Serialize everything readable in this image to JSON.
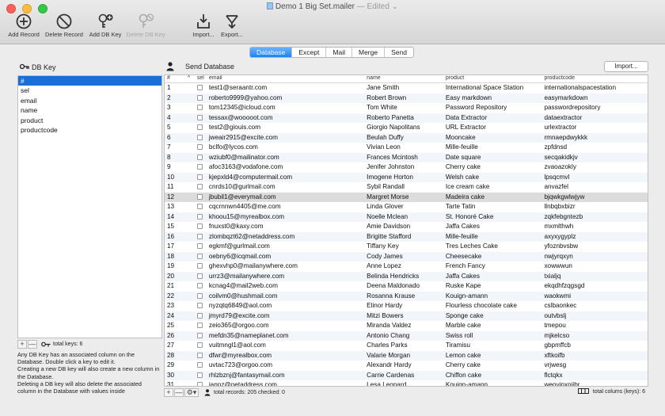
{
  "window": {
    "title": "Demo 1 Big Set.mailer",
    "edited": "— Edited",
    "chevron": "⌄"
  },
  "toolbar": {
    "add_record": "Add Record",
    "delete_record": "Delete Record",
    "add_db_key": "Add DB Key",
    "delete_db_key": "Delete DB Key",
    "import": "Import...",
    "export": "Export..."
  },
  "tabs": [
    "Database",
    "Except",
    "Mail",
    "Merge",
    "Send"
  ],
  "active_tab": "Database",
  "left": {
    "header": "DB Key",
    "keys": [
      "#",
      "sel",
      "email",
      "name",
      "product",
      "productcode"
    ],
    "selected_key": "#",
    "add": "+",
    "remove": "—",
    "total_keys": "total keys: 6",
    "help": "Any DB Key has an associated column on the Database. Double click a key to edit it.\nCreating a new DB key will also create a new column in the Database.\nDeleting a DB key will also delete the associated column in the Database with values inside"
  },
  "right": {
    "header": "Send Database",
    "import_button": "Import...",
    "columns": {
      "num": "#",
      "sort": "^",
      "sel": "sel",
      "email": "email",
      "name": "name",
      "product": "product",
      "productcode": "productcode"
    },
    "rows": [
      [
        "1",
        "test1@seraantr.com",
        "Jane Smith",
        "International Space Station",
        "internationalspacestation"
      ],
      [
        "2",
        "roberto9999@yahoo.com",
        "Robert Brown",
        "Easy markdown",
        "easymarkdown"
      ],
      [
        "3",
        "tom12345@icloud.com",
        "Tom White",
        "Password Repository",
        "passwordrepository"
      ],
      [
        "4",
        "tessax@wooooot.com",
        "Roberto Panetta",
        "Data Extractor",
        "dataextractor"
      ],
      [
        "5",
        "test2@giouis.com",
        "Giorgio Napolitans",
        "URL Extractor",
        "urlextractor"
      ],
      [
        "6",
        "jweair2915@excite.com",
        "Beulah Duffy",
        "Mooncake",
        "rmnaepdwykkk"
      ],
      [
        "7",
        "bclfo@lycos.com",
        "Vivian Leon",
        "Mille-feuille",
        "zpfdnsd"
      ],
      [
        "8",
        "wziubf0@mailinator.com",
        "Frances Mcintosh",
        "Date square",
        "secqakidkjv"
      ],
      [
        "9",
        "afoc3163@vodafone.com",
        "Jenifer Johnston",
        "Cherry cake",
        "zvaoazokly"
      ],
      [
        "10",
        "kjepxld4@computermail.com",
        "Imogene Horton",
        "Welsh cake",
        "lpsqcmvl"
      ],
      [
        "11",
        "cnrds10@gurlmail.com",
        "Sybil Randall",
        "Ice cream cake",
        "anvazfel"
      ],
      [
        "12",
        "jbubil1@everymail.com",
        "Margret Morse",
        "Madeira cake",
        "bjqwkgwlwjyw"
      ],
      [
        "13",
        "cqcrnnwn4405@me.com",
        "Linda Glover",
        "Tarte Tatin",
        "llnbqbxbizr"
      ],
      [
        "14",
        "khoou15@myrealbox.com",
        "Noelle Mclean",
        "St. Honoré Cake",
        "zqkfebgntezb"
      ],
      [
        "15",
        "fnuxst0@kaxy.com",
        "Amie Davidson",
        "Jaffa Cakes",
        "mxmlthwh"
      ],
      [
        "16",
        "zlombqzt62@netaddress.com",
        "Brigitte Stafford",
        "Mille-feuille",
        "axyxygyplz"
      ],
      [
        "17",
        "egkmf@gurlmail.com",
        "Tiffany Key",
        "Tres Leches Cake",
        "yfoznbvsbw"
      ],
      [
        "18",
        "oebny6@icqmail.com",
        "Cody James",
        "Cheesecake",
        "nwjyrqxyn"
      ],
      [
        "19",
        "ghexvhp0@mailanywhere.com",
        "Anne Lopez",
        "French Fancy",
        "xowwwun"
      ],
      [
        "20",
        "urrz3@mailanywhere.com",
        "Belinda Hendricks",
        "Jaffa Cakes",
        "txialjq"
      ],
      [
        "21",
        "kcnag4@mail2web.com",
        "Deena Maldonado",
        "Ruske Kape",
        "ekqdhfzqgsgd"
      ],
      [
        "22",
        "coilvm0@hushmail.com",
        "Rosanna Krause",
        "Kouign-amann",
        "waokwmi"
      ],
      [
        "23",
        "nyzqtq6849@aol.com",
        "Elinor Hardy",
        "Flourless chocolate cake",
        "cslbaonkec"
      ],
      [
        "24",
        "jmyrd79@excite.com",
        "Mitzi Bowers",
        "Sponge cake",
        "outvbslj"
      ],
      [
        "25",
        "zeio365@orgoo.com",
        "Miranda Valdez",
        "Marble cake",
        "tmepou"
      ],
      [
        "26",
        "mefdn35@nameplanet.com",
        "Antonio Chang",
        "Swiss roll",
        "mjkelcso"
      ],
      [
        "27",
        "vuitmngl1@aol.com",
        "Charles Parks",
        "Tiramisu",
        "gbpmffcb"
      ],
      [
        "28",
        "dfwr@myrealbox.com",
        "Valarie Morgan",
        "Lemon cake",
        "xftkoifb"
      ],
      [
        "29",
        "uvtac723@orgoo.com",
        "Alexandr Hardy",
        "Cherry cake",
        "vrjwesg"
      ],
      [
        "30",
        "rhlzbznj@fantasymail.com",
        "Carrie Cardenas",
        "Chiffon cake",
        "flctqkx"
      ],
      [
        "31",
        "ianpz@netaddress.com",
        "Lesa Leonard",
        "Kouign-amann",
        "weoyjpxnjjbr"
      ]
    ],
    "highlighted_row": "12",
    "add": "+",
    "remove": "—",
    "gear": "⚙▾",
    "total_records": "total records: 205 checked: 0",
    "total_columns": "total colums (keys): 6"
  }
}
